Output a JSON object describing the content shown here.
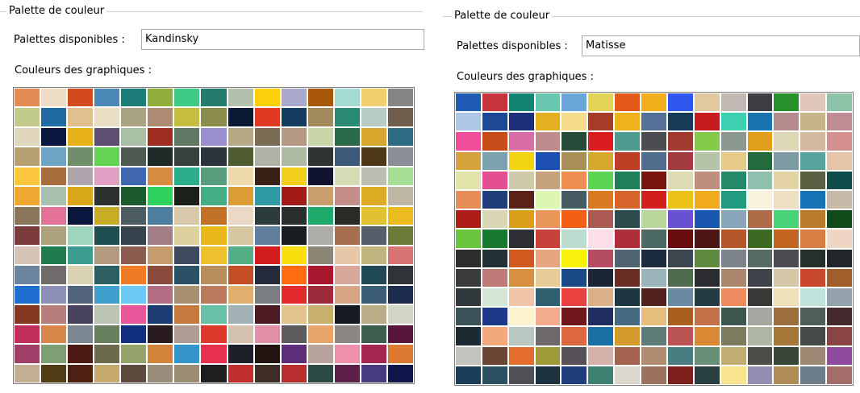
{
  "left": {
    "group_title": "Palette de couleur",
    "palette_label": "Palettes disponibles :",
    "palette_value": "Kandinsky",
    "colors_label": "Couleurs des graphiques :",
    "swatches": [
      "#E38B55",
      "#EEDCC7",
      "#D4491E",
      "#4B88B6",
      "#1B7C77",
      "#8FAE3A",
      "#3EC985",
      "#237C6E",
      "#B3C0AE",
      "#FDD20C",
      "#A8A9CB",
      "#A8570B",
      "#A3DBD5",
      "#F1CF6D",
      "#868484",
      "#C3CB8C",
      "#1D6BA2",
      "#DFC18D",
      "#E9DEC4",
      "#A8A182",
      "#AD8A72",
      "#C6BE40",
      "#8B8B4C",
      "#0B1A33",
      "#DE3A24",
      "#133C5F",
      "#A28A5A",
      "#2B8A74",
      "#B7CCC7",
      "#6F5E4C",
      "#E0D5BD",
      "#0A1640",
      "#E7B11C",
      "#5D5072",
      "#A9BFA6",
      "#9E2E22",
      "#5F7965",
      "#9A8FCC",
      "#B7A987",
      "#7B6C55",
      "#B49A84",
      "#C9D7A8",
      "#2A694A",
      "#D8A72E",
      "#2E6C86",
      "#B7A072",
      "#6BA5C3",
      "#6F8E6A",
      "#62D451",
      "#4E5A52",
      "#1D2A28",
      "#37413D",
      "#2C343B",
      "#4F5C2F",
      "#B0B2A7",
      "#ACB9A3",
      "#2E3333",
      "#3E5A7A",
      "#4E3818",
      "#8B8E97",
      "#FBC53D",
      "#A96E3D",
      "#AEA5AD",
      "#E39EC4",
      "#3F66AF",
      "#D58E3F",
      "#2AAE89",
      "#569C7D",
      "#ECDAA8",
      "#3A2118",
      "#F0CE1A",
      "#0F1330",
      "#D7DCB6",
      "#BCBEB1",
      "#A6DE96",
      "#F0A732",
      "#A9C0B0",
      "#D8A619",
      "#2B322F",
      "#1B5B2C",
      "#2ED25E",
      "#1B2019",
      "#45AE87",
      "#DC9D35",
      "#2F9AA4",
      "#A21B18",
      "#C99E6C",
      "#C38D88",
      "#DDAB22",
      "#BFB5A5",
      "#8A765B",
      "#E47198",
      "#0B163F",
      "#C7AC25",
      "#4C5B5F",
      "#4D7E9F",
      "#D7C9A9",
      "#C17027",
      "#EAD9C6",
      "#2B3C3A",
      "#2A2F2E",
      "#1FA96A",
      "#2C2A25",
      "#E0C12F",
      "#EBBB20",
      "#7B3B3C",
      "#ABA17C",
      "#9FD4BE",
      "#1E4E50",
      "#36434D",
      "#A27E86",
      "#DFD0A0",
      "#E9B91A",
      "#D6C8A1",
      "#5F7F9B",
      "#1A1D22",
      "#ADACA7",
      "#A66F4F",
      "#555F6A",
      "#6B7B3A",
      "#D5C3B8",
      "#1F7C4F",
      "#3C9C8F",
      "#B29980",
      "#8A5B4F",
      "#C59C6E",
      "#404A5F",
      "#EDC02D",
      "#54AE86",
      "#D21C1D",
      "#F7E00C",
      "#8B8576",
      "#E6C8A8",
      "#C2B47F",
      "#D77373",
      "#6B85A0",
      "#6F6B6A",
      "#D9D2B2",
      "#2C5F62",
      "#F07B27",
      "#8B4B3C",
      "#2A5166",
      "#B98E5D",
      "#C54E27",
      "#252A3D",
      "#FE6D10",
      "#A8172E",
      "#DAA79B",
      "#1F4A55",
      "#2F3537",
      "#1E6FD0",
      "#8E8FB6",
      "#52637C",
      "#3FA0CE",
      "#6DC8F5",
      "#B36E86",
      "#A79170",
      "#BB7A5E",
      "#E0AF6D",
      "#7B7E80",
      "#E22A2E",
      "#9E2B3B",
      "#D8A584",
      "#3B5E76",
      "#1C2C4E",
      "#85381F",
      "#B77F7B",
      "#4A4360",
      "#BBC4B2",
      "#EA569A",
      "#1D3D72",
      "#C77A3F",
      "#68C0A7",
      "#A1B1B6",
      "#4C1B23",
      "#E2C58C",
      "#C8AF6E",
      "#161A24",
      "#B9AE87",
      "#D3D7C8",
      "#C1305A",
      "#D8864A",
      "#7A8792",
      "#687F5D",
      "#10307D",
      "#2A1C1E",
      "#AE9C94",
      "#DD3A2D",
      "#D5C1B0",
      "#E190A8",
      "#5E5B5C",
      "#E8A56A",
      "#8B8583",
      "#3C5E4D",
      "#59153C",
      "#A23F69",
      "#7D9F73",
      "#4E1A14",
      "#6B6A4C",
      "#93A36B",
      "#D18339",
      "#3595C8",
      "#E6304D",
      "#1D1F2A",
      "#221511",
      "#5C2D7B",
      "#B8A49C",
      "#EE8FAB",
      "#A62550",
      "#DD7932",
      "#C3AE92",
      "#4F3C14",
      "#4E2012",
      "#C7A86D",
      "#5B4A3D",
      "#9A8C7A",
      "#9A8D74",
      "#1E1E1E",
      "#C02F2E",
      "#3E2D24",
      "#B82E2F",
      "#2B4842",
      "#5C1F4A",
      "#473A7E",
      "#0F174A"
    ]
  },
  "right": {
    "group_title": "Palette de couleur",
    "palette_label": "Palettes disponibles :",
    "palette_value": "Matisse",
    "colors_label": "Couleurs des graphiques :",
    "swatches": [
      "#1D5BB4",
      "#C8343C",
      "#118473",
      "#6AC6AE",
      "#6AA6DA",
      "#E2D357",
      "#E3591A",
      "#F2AE1C",
      "#2F56EE",
      "#E1C8A1",
      "#C3B8B3",
      "#3C3E43",
      "#26902A",
      "#E1C6BE",
      "#8FC3A9",
      "#AEC6E8",
      "#1C4896",
      "#1D2F79",
      "#E2B020",
      "#F5DC8D",
      "#A63B27",
      "#EEB31B",
      "#557096",
      "#163B59",
      "#C71C1E",
      "#3FD0B1",
      "#1875AE",
      "#B68B8B",
      "#C7B589",
      "#C08D97",
      "#F04D9A",
      "#C84C19",
      "#DA6CA7",
      "#C08B8E",
      "#244A38",
      "#D91C1E",
      "#4E9A8E",
      "#4B4D50",
      "#A23A31",
      "#84CA49",
      "#8A988F",
      "#DF9F1A",
      "#DCD8B6",
      "#D4B99E",
      "#D48F8E",
      "#D4A33C",
      "#7DA0AE",
      "#F2D310",
      "#1D4FB0",
      "#A78F55",
      "#D4A92E",
      "#BC3E25",
      "#4F6E8E",
      "#A13A3E",
      "#B7C3A6",
      "#E7C98A",
      "#226B3C",
      "#7D9BA2",
      "#58A49C",
      "#E5C5A8",
      "#E0E4A9",
      "#E34F90",
      "#CFCAA9",
      "#C5A27E",
      "#EE8F4F",
      "#5ED552",
      "#1F7F5A",
      "#7A140F",
      "#DCDBB1",
      "#C08E7D",
      "#278A6A",
      "#8FC0AD",
      "#E4D3A5",
      "#596142",
      "#0F4D4A",
      "#E78E58",
      "#1D3E78",
      "#5A2217",
      "#DDF6B2",
      "#465A62",
      "#DA7A20",
      "#D6632A",
      "#D21F1C",
      "#EBC218",
      "#F3AB1E",
      "#219A80",
      "#F8F1DC",
      "#EDDFC1",
      "#1572B4",
      "#C6BBA8",
      "#AE1E19",
      "#DBD6B6",
      "#DCA018",
      "#E89659",
      "#F35D14",
      "#AB5952",
      "#2D4B4D",
      "#BAD79B",
      "#6951D4",
      "#1A58B0",
      "#87A6BA",
      "#AF6C49",
      "#47D478",
      "#B77B2A",
      "#0F4C19",
      "#6AC63C",
      "#19792F",
      "#2E2E35",
      "#C8413A",
      "#BDDCCF",
      "#FCDEE7",
      "#AE2E3A",
      "#4C6A63",
      "#680D0F",
      "#4F1616",
      "#B5562A",
      "#3D6A22",
      "#C2651F",
      "#D87E45",
      "#EED5C4",
      "#2E2B2D",
      "#233036",
      "#D2591F",
      "#E6A67F",
      "#F8F10B",
      "#B54C62",
      "#4F6370",
      "#1C2C3E",
      "#3D4750",
      "#608A3E",
      "#7D858A",
      "#556B63",
      "#4C4B52",
      "#262F2A",
      "#20262A",
      "#393B3C",
      "#BE7B77",
      "#D79040",
      "#E6CC96",
      "#1A4A85",
      "#1A2538",
      "#6A2D25",
      "#9BB3BA",
      "#4F6B50",
      "#2A2C30",
      "#AB876D",
      "#3E4449",
      "#D5C7A7",
      "#C9472A",
      "#A05E2A",
      "#32393C",
      "#D5E5D6",
      "#F0C4A6",
      "#2F5F6F",
      "#E84140",
      "#DBB087",
      "#1E363F",
      "#51221F",
      "#6A8AA1",
      "#243B41",
      "#EE8A60",
      "#3B3937",
      "#EEE0B9",
      "#BEE3DB",
      "#94A2AB",
      "#3A5359",
      "#1D3987",
      "#FCF3CC",
      "#F2AC8D",
      "#71161A",
      "#1F2E5E",
      "#466B81",
      "#E5BE7E",
      "#AB5F1D",
      "#C46F48",
      "#3E5650",
      "#A6A6A0",
      "#9C6E3D",
      "#4E5F57",
      "#442A2C",
      "#1C2B31",
      "#F4A97C",
      "#B8C8C1",
      "#6E6A6B",
      "#DD6740",
      "#1A6FA4",
      "#D49A2C",
      "#5E7B77",
      "#BA5353",
      "#DA8932",
      "#7D7B5D",
      "#AEB6A4",
      "#A5783A",
      "#474B47",
      "#8B4444",
      "#C2C4C0",
      "#6B4534",
      "#E56D2D",
      "#9F9A38",
      "#555157",
      "#D4B1AB",
      "#A2624D",
      "#B08C71",
      "#497E80",
      "#679077",
      "#C4AD74",
      "#4E4C49",
      "#38463A",
      "#9E8A74",
      "#8E4BA0",
      "#1B3E5A",
      "#2B5061",
      "#4F5056",
      "#1D3341",
      "#203E7C",
      "#3E806F",
      "#DCD8CE",
      "#9A725D",
      "#7D1F1B",
      "#27403F",
      "#FAE38F",
      "#948FB2",
      "#AF8C55",
      "#6E7D8A",
      "#A46D6A"
    ]
  }
}
